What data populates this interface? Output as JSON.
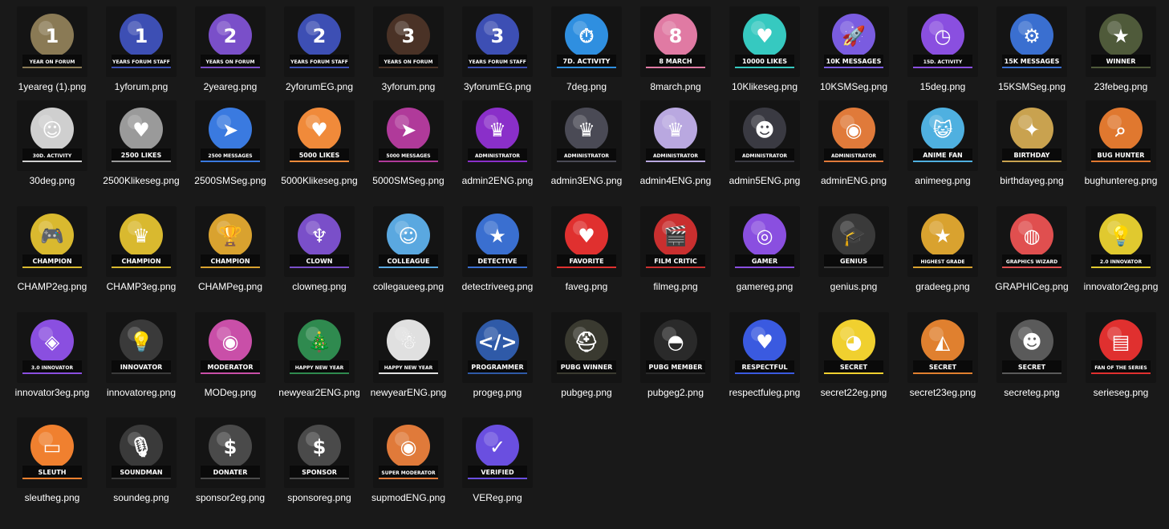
{
  "files": [
    {
      "name": "1yeareg (1).png",
      "label": "YEAR ON FORUM",
      "icon": "medal-1-bronze-icon",
      "color": "#8a7a55",
      "glyph": "1"
    },
    {
      "name": "1yforum.png",
      "label": "YEARS FORUM STAFF",
      "icon": "medal-1-blue-icon",
      "color": "#3d4fb4",
      "glyph": "1"
    },
    {
      "name": "2yeareg.png",
      "label": "YEARS ON FORUM",
      "icon": "medal-2-purple-icon",
      "color": "#7a4fc9",
      "glyph": "2"
    },
    {
      "name": "2yforumEG.png",
      "label": "YEARS FORUM STAFF",
      "icon": "medal-2-blue-icon",
      "color": "#3d4fb4",
      "glyph": "2"
    },
    {
      "name": "3yforum.png",
      "label": "YEARS ON FORUM",
      "icon": "cake-icon",
      "color": "#4a3226",
      "glyph": "3"
    },
    {
      "name": "3yforumEG.png",
      "label": "YEARS FORUM STAFF",
      "icon": "medal-3-blue-icon",
      "color": "#3d4fb4",
      "glyph": "3"
    },
    {
      "name": "7deg.png",
      "label": "7D. ACTIVITY",
      "icon": "stopwatch-icon",
      "color": "#2f8fe0",
      "glyph": "⏱"
    },
    {
      "name": "8march.png",
      "label": "8 MARCH",
      "icon": "flower-eight-icon",
      "color": "#e07aa3",
      "glyph": "8"
    },
    {
      "name": "10Klikeseg.png",
      "label": "10000 LIKES",
      "icon": "heart-bubble-icon",
      "color": "#36c9c0",
      "glyph": "♥"
    },
    {
      "name": "10KSMSeg.png",
      "label": "10K MESSAGES",
      "icon": "rocket-icon",
      "color": "#7a5ce0",
      "glyph": "🚀"
    },
    {
      "name": "15deg.png",
      "label": "15D. ACTIVITY",
      "icon": "clock-icon",
      "color": "#8a4fe0",
      "glyph": "◷"
    },
    {
      "name": "15KSMSeg.png",
      "label": "15K MESSAGES",
      "icon": "robot-icon",
      "color": "#3a6fd0",
      "glyph": "⚙"
    },
    {
      "name": "23febeg.png",
      "label": "WINNER",
      "icon": "soldier-helmet-icon",
      "color": "#4f5a3a",
      "glyph": "★"
    },
    {
      "name": "30deg.png",
      "label": "30D. ACTIVITY",
      "icon": "astronaut-icon",
      "color": "#cfcfcf",
      "glyph": "☺"
    },
    {
      "name": "2500Klikeseg.png",
      "label": "2500 LIKES",
      "icon": "heart-bubble-icon",
      "color": "#9a9a9a",
      "glyph": "♥"
    },
    {
      "name": "2500SMSeg.png",
      "label": "2500 MESSAGES",
      "icon": "paper-plane-icon",
      "color": "#3a7ae0",
      "glyph": "➤"
    },
    {
      "name": "5000Klikeseg.png",
      "label": "5000 LIKES",
      "icon": "heart-bubble-icon",
      "color": "#f08a3a",
      "glyph": "♥"
    },
    {
      "name": "5000SMSeg.png",
      "label": "5000 MESSAGES",
      "icon": "paper-plane-icon",
      "color": "#b03a9a",
      "glyph": "➤"
    },
    {
      "name": "admin2ENG.png",
      "label": "ADMINISTRATOR",
      "icon": "crown-icon",
      "color": "#8a2fc9",
      "glyph": "♛"
    },
    {
      "name": "admin3ENG.png",
      "label": "ADMINISTRATOR",
      "icon": "crown-icon",
      "color": "#4a4a55",
      "glyph": "♛"
    },
    {
      "name": "admin4ENG.png",
      "label": "ADMINISTRATOR",
      "icon": "crown-icon",
      "color": "#b9a8e0",
      "glyph": "♛"
    },
    {
      "name": "admin5ENG.png",
      "label": "ADMINISTRATOR",
      "icon": "hooded-figure-icon",
      "color": "#3a3a42",
      "glyph": "☻"
    },
    {
      "name": "adminENG.png",
      "label": "ADMINISTRATOR",
      "icon": "eye-robot-icon",
      "color": "#e07a3a",
      "glyph": "◉"
    },
    {
      "name": "animeeg.png",
      "label": "ANIME FAN",
      "icon": "anime-cat-icon",
      "color": "#4fb0e0",
      "glyph": "😺"
    },
    {
      "name": "birthdayeg.png",
      "label": "BIRTHDAY",
      "icon": "party-popper-icon",
      "color": "#c9a24f",
      "glyph": "✦"
    },
    {
      "name": "bughuntereg.png",
      "label": "BUG HUNTER",
      "icon": "bug-magnifier-icon",
      "color": "#e0782f",
      "glyph": "⌕"
    },
    {
      "name": "CHAMP2eg.png",
      "label": "CHAMPION",
      "icon": "gamepad-trophy-icon",
      "color": "#d9b92f",
      "glyph": "🎮"
    },
    {
      "name": "CHAMP3eg.png",
      "label": "CHAMPION",
      "icon": "gamepad-crown-icon",
      "color": "#d9b92f",
      "glyph": "♛"
    },
    {
      "name": "CHAMPeg.png",
      "label": "CHAMPION",
      "icon": "trophy-icon",
      "color": "#d9a22f",
      "glyph": "🏆"
    },
    {
      "name": "clowneg.png",
      "label": "CLOWN",
      "icon": "jester-hat-icon",
      "color": "#7a4fc9",
      "glyph": "♆"
    },
    {
      "name": "collegaueeg.png",
      "label": "COLLEAGUE",
      "icon": "robot-icon",
      "color": "#5aa8e0",
      "glyph": "☺"
    },
    {
      "name": "detectriveeg.png",
      "label": "DETECTIVE",
      "icon": "sheriff-star-icon",
      "color": "#3a6fd0",
      "glyph": "★"
    },
    {
      "name": "faveg.png",
      "label": "FAVORITE",
      "icon": "heart-bubble-icon",
      "color": "#e0302f",
      "glyph": "♥"
    },
    {
      "name": "filmeg.png",
      "label": "FILM CRITIC",
      "icon": "director-chair-icon",
      "color": "#c92f2f",
      "glyph": "🎬"
    },
    {
      "name": "gamereg.png",
      "label": "GAMER",
      "icon": "vr-headset-icon",
      "color": "#8a4fe0",
      "glyph": "◎"
    },
    {
      "name": "genius.png",
      "label": "GENIUS",
      "icon": "graduation-cap-icon",
      "color": "#3a3a3a",
      "glyph": "🎓"
    },
    {
      "name": "gradeeg.png",
      "label": "HIGHEST GRADE",
      "icon": "gold-medal-icon",
      "color": "#d9a22f",
      "glyph": "★"
    },
    {
      "name": "GRAPHICeg.png",
      "label": "GRAPHICS WIZARD",
      "icon": "color-wheel-icon",
      "color": "#e04f4f",
      "glyph": "◍"
    },
    {
      "name": "innovator2eg.png",
      "label": "2.0 INNOVATOR",
      "icon": "lightbulb-icon",
      "color": "#e0c92f",
      "glyph": "💡"
    },
    {
      "name": "innovator3eg.png",
      "label": "3.0 INNOVATOR",
      "icon": "brain-chip-icon",
      "color": "#8a4fe0",
      "glyph": "◈"
    },
    {
      "name": "innovatoreg.png",
      "label": "INNOVATOR",
      "icon": "lightbulb-icon",
      "color": "#3a3a3a",
      "glyph": "💡"
    },
    {
      "name": "MODeg.png",
      "label": "MODERATOR",
      "icon": "eye-icon",
      "color": "#c94fa8",
      "glyph": "◉"
    },
    {
      "name": "newyear2ENG.png",
      "label": "HAPPY NEW YEAR",
      "icon": "christmas-tree-icon",
      "color": "#2f8a4f",
      "glyph": "🎄"
    },
    {
      "name": "newyearENG.png",
      "label": "HAPPY NEW YEAR",
      "icon": "snowman-icon",
      "color": "#e0e0e0",
      "glyph": "☃"
    },
    {
      "name": "progeg.png",
      "label": "PROGRAMMER",
      "icon": "coffee-mug-icon",
      "color": "#2f5aa8",
      "glyph": "</>"
    },
    {
      "name": "pubgeg.png",
      "label": "PUBG WINNER",
      "icon": "pubg-helmet-icon",
      "color": "#3a3a30",
      "glyph": "⛑"
    },
    {
      "name": "pubgeg2.png",
      "label": "PUBG MEMBER",
      "icon": "frying-pan-icon",
      "color": "#2a2a2a",
      "glyph": "◓"
    },
    {
      "name": "respectfuleg.png",
      "label": "RESPECTFUL",
      "icon": "heart-bubble-icon",
      "color": "#3a5ae0",
      "glyph": "♥"
    },
    {
      "name": "secret22eg.png",
      "label": "SECRET",
      "icon": "rubber-duck-icon",
      "color": "#f0d02f",
      "glyph": "◕"
    },
    {
      "name": "secret23eg.png",
      "label": "SECRET",
      "icon": "pizza-icon",
      "color": "#e0802f",
      "glyph": "◭"
    },
    {
      "name": "secreteg.png",
      "label": "SECRET",
      "icon": "mask-icon",
      "color": "#5a5a5a",
      "glyph": "☻"
    },
    {
      "name": "serieseg.png",
      "label": "FAN OF THE SERIES",
      "icon": "popcorn-icon",
      "color": "#e0302f",
      "glyph": "▤"
    },
    {
      "name": "sleutheg.png",
      "label": "SLEUTH",
      "icon": "top-secret-folder-icon",
      "color": "#f0802f",
      "glyph": "▭"
    },
    {
      "name": "soundeg.png",
      "label": "SOUNDMAN",
      "icon": "microphone-icon",
      "color": "#3a3a3a",
      "glyph": "🎙"
    },
    {
      "name": "sponsor2eg.png",
      "label": "DONATER",
      "icon": "money-stack-icon",
      "color": "#4a4a4a",
      "glyph": "$"
    },
    {
      "name": "sponsoreg.png",
      "label": "SPONSOR",
      "icon": "money-stack-icon",
      "color": "#4a4a4a",
      "glyph": "$"
    },
    {
      "name": "supmodENG.png",
      "label": "SUPER MODERATOR",
      "icon": "eye-robot-icon",
      "color": "#e07a3a",
      "glyph": "◉"
    },
    {
      "name": "VEReg.png",
      "label": "VERIFIED",
      "icon": "checkmark-badge-icon",
      "color": "#6a4fe0",
      "glyph": "✓"
    }
  ]
}
